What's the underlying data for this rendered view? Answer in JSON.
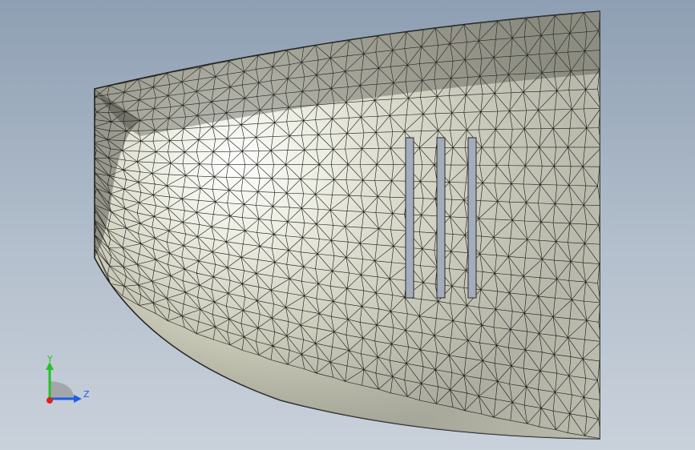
{
  "triad": {
    "y_label": "Y",
    "z_label": "Z",
    "colors": {
      "y": "#22c322",
      "z": "#1e5ee8",
      "x": "#e02020"
    }
  },
  "model": {
    "name": "mesh-shell",
    "surface_color": "#e9eadc",
    "edge_color": "#1a1a1a",
    "slot_color": "#a3adbb"
  }
}
